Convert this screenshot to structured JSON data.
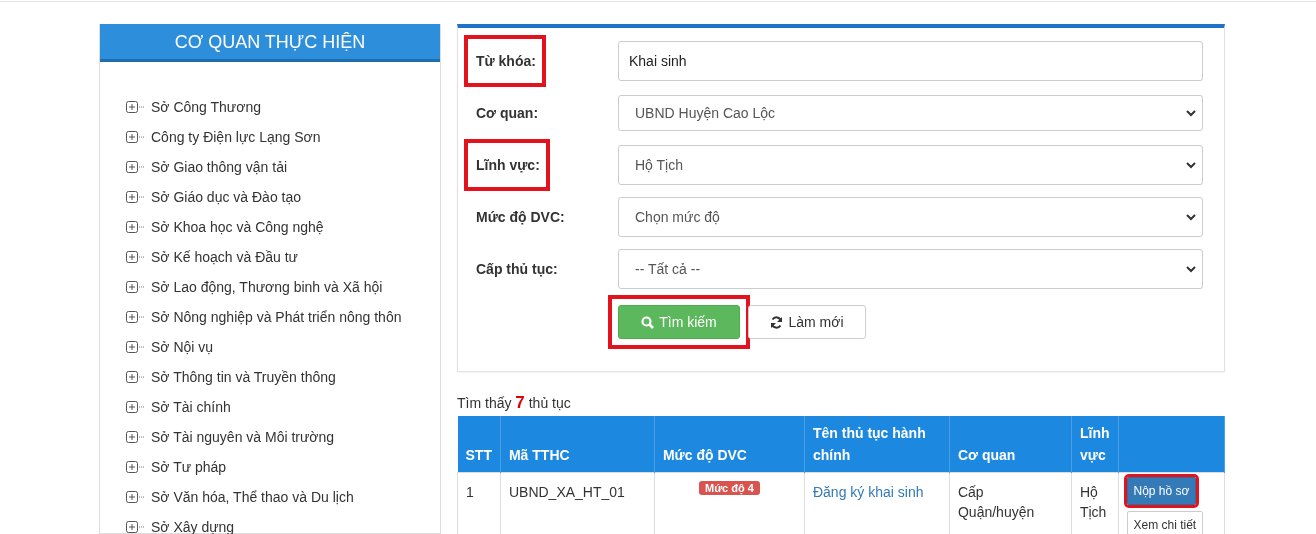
{
  "sidebar": {
    "title": "CƠ QUAN THỰC HIỆN",
    "items": [
      {
        "label": "Sở Công Thương",
        "expanded": false
      },
      {
        "label": "Công ty Điện lực Lạng Sơn",
        "expanded": false
      },
      {
        "label": "Sở Giao thông vận tải",
        "expanded": false
      },
      {
        "label": "Sở Giáo dục và Đào tạo",
        "expanded": false
      },
      {
        "label": "Sở Khoa học và Công nghệ",
        "expanded": false
      },
      {
        "label": "Sở Kế hoạch và Đầu tư",
        "expanded": false
      },
      {
        "label": "Sở Lao động, Thương binh và Xã hội",
        "expanded": false
      },
      {
        "label": "Sở Nông nghiệp và Phát triển nông thôn",
        "expanded": false
      },
      {
        "label": "Sở Nội vụ",
        "expanded": false
      },
      {
        "label": "Sở Thông tin và Truyền thông",
        "expanded": false
      },
      {
        "label": "Sở Tài chính",
        "expanded": false
      },
      {
        "label": "Sở Tài nguyên và Môi trường",
        "expanded": false
      },
      {
        "label": "Sở Tư pháp",
        "expanded": false
      },
      {
        "label": "Sở Văn hóa, Thể thao và Du lịch",
        "expanded": false
      },
      {
        "label": "Sở Xây dựng",
        "expanded": false
      }
    ]
  },
  "form": {
    "fields": [
      {
        "label": "Từ khóa:",
        "kind": "text",
        "value": "Khai sinh",
        "highlighted": true
      },
      {
        "label": "Cơ quan:",
        "kind": "select",
        "value": "UBND Huyện Cao Lộc",
        "highlighted": false
      },
      {
        "label": "Lĩnh vực:",
        "kind": "select",
        "value": "Hộ Tịch",
        "highlighted": true
      },
      {
        "label": "Mức độ DVC:",
        "kind": "select",
        "value": "Chọn mức độ",
        "highlighted": false
      },
      {
        "label": "Cấp thủ tục:",
        "kind": "select",
        "value": "-- Tất cả --",
        "highlighted": false
      }
    ],
    "buttons": [
      {
        "label": "Tìm kiếm",
        "kind": "search",
        "highlighted": true
      },
      {
        "label": "Làm mới",
        "kind": "refresh",
        "highlighted": false
      }
    ]
  },
  "results": {
    "prefix": "Tìm thấy",
    "count": "7",
    "suffix": "thủ tục"
  },
  "table": {
    "columns": [
      "STT",
      "Mã TTHC",
      "Mức độ DVC",
      "Tên thủ tục hành chính",
      "Cơ quan",
      "Lĩnh vực",
      ""
    ],
    "rows": [
      {
        "stt": "1",
        "code": "UBND_XA_HT_01",
        "level": "Mức độ 4",
        "name": "Đăng ký khai sinh",
        "agency": "Cấp Quận/huyện",
        "field": "Hộ Tịch",
        "actions": [
          {
            "label": "Nộp hồ sơ",
            "kind": "primary",
            "highlighted": true
          },
          {
            "label": "Xem chi tiết",
            "kind": "default",
            "highlighted": false
          }
        ]
      }
    ]
  }
}
